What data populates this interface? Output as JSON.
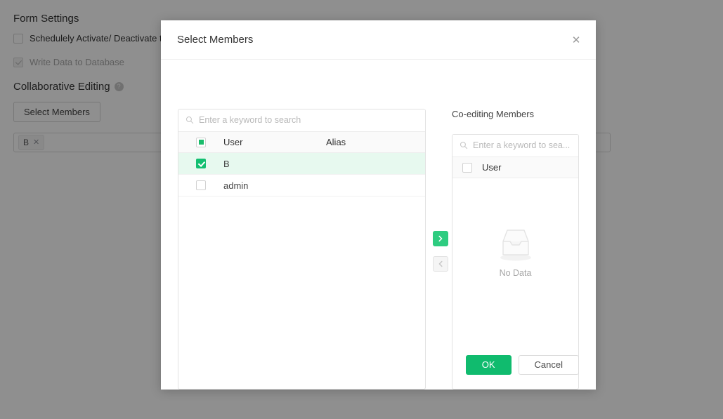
{
  "background": {
    "form_settings_title": "Form Settings",
    "schedule_checkbox_label": "Schedulely Activate/ Deactivate the",
    "write_db_checkbox_label": "Write Data to Database",
    "collaborative_editing_title": "Collaborative Editing",
    "help_glyph": "?",
    "select_members_button": "Select Members",
    "member_tag": "B",
    "tag_remove_glyph": "✕"
  },
  "dialog": {
    "title": "Select Members",
    "close_glyph": "✕",
    "left_panel": {
      "search_placeholder": "Enter a keyword to search",
      "columns": [
        "User",
        "Alias"
      ],
      "rows": [
        {
          "user": "B",
          "alias": "",
          "checked": true
        },
        {
          "user": "admin",
          "alias": "",
          "checked": false
        }
      ]
    },
    "transfer": {
      "to_right_glyph": "›",
      "to_left_glyph": "‹"
    },
    "right_panel": {
      "label": "Co-editing Members",
      "search_placeholder": "Enter a keyword to sea...",
      "columns": [
        "User"
      ],
      "rows": [],
      "empty_text": "No Data"
    },
    "footer": {
      "ok_label": "OK",
      "cancel_label": "Cancel"
    }
  },
  "colors": {
    "accent_green": "#10bb6e",
    "selected_row": "#e7f9ef",
    "overlay": "rgba(0,0,0,0.44)"
  }
}
